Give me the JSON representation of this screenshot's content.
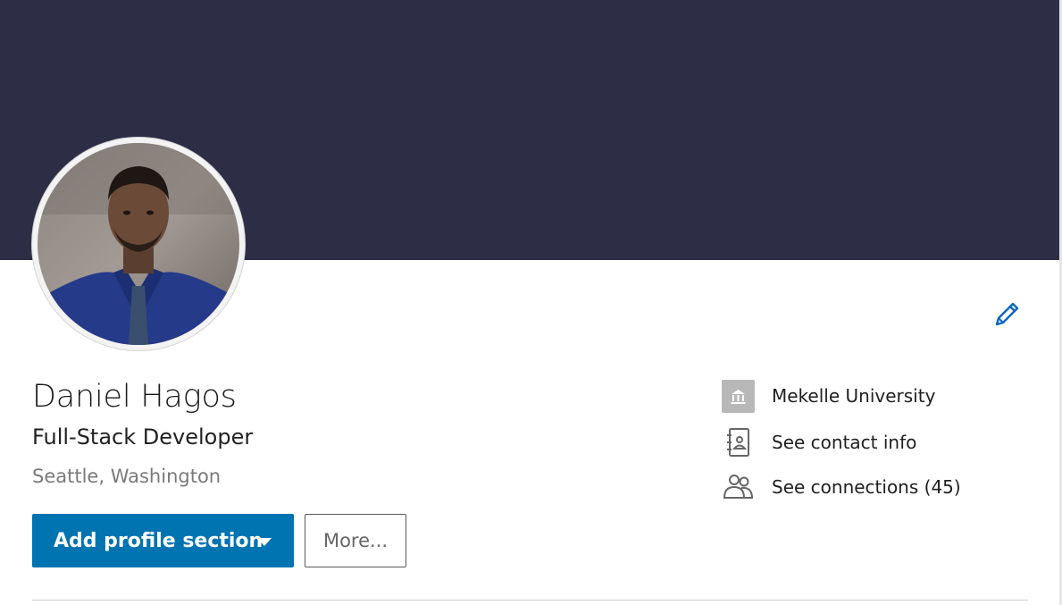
{
  "profile": {
    "name": "Daniel Hagos",
    "headline": "Full-Stack Developer",
    "location": "Seattle, Washington"
  },
  "actions": {
    "add_section_label": "Add profile section",
    "more_label": "More..."
  },
  "info": {
    "education": "Mekelle University",
    "contact_info": "See contact info",
    "connections": "See connections (45)"
  },
  "icons": {
    "edit": "pencil-icon",
    "education": "school-icon",
    "contact": "address-book-icon",
    "connections": "people-icon",
    "dropdown": "caret-down-icon"
  },
  "colors": {
    "banner": "#2d2e45",
    "primary": "#0073b1",
    "edit_icon": "#0a66c2"
  }
}
